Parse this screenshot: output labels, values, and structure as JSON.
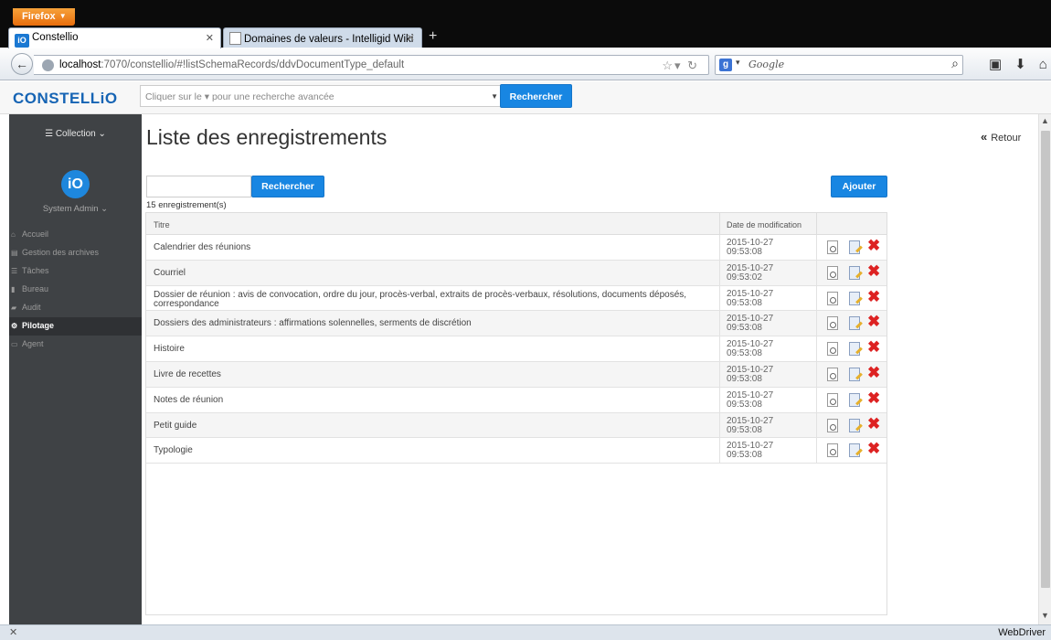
{
  "browser": {
    "menu_label": "Firefox",
    "tabs": [
      {
        "title": "Constellio",
        "favicon": "io"
      },
      {
        "title": "Domaines de valeurs - Intelligid Wiki",
        "favicon": "doc"
      }
    ],
    "url_host": "localhost",
    "url_rest": ":7070/constellio/#!listSchemaRecords/ddvDocumentType_default",
    "search_placeholder": "Google",
    "status_right": "WebDriver"
  },
  "app": {
    "logo": "CONSTELLiO",
    "search_placeholder": "Cliquer sur le ▾ pour une recherche avancée",
    "search_button": "Rechercher"
  },
  "sidebar": {
    "collection": "Collection",
    "avatar": "iO",
    "user": "System Admin",
    "items": [
      {
        "label": "Accueil",
        "icon": "home-icon",
        "active": false
      },
      {
        "label": "Gestion des archives",
        "icon": "archive-icon",
        "active": false
      },
      {
        "label": "Tâches",
        "icon": "tasks-icon",
        "active": false
      },
      {
        "label": "Bureau",
        "icon": "briefcase-icon",
        "active": false
      },
      {
        "label": "Audit",
        "icon": "audit-icon",
        "active": false
      },
      {
        "label": "Pilotage",
        "icon": "gears-icon",
        "active": true
      },
      {
        "label": "Agent",
        "icon": "laptop-icon",
        "active": false
      }
    ]
  },
  "main": {
    "title": "Liste des enregistrements",
    "back": "Retour",
    "search_button": "Rechercher",
    "add_button": "Ajouter",
    "count": "15 enregistrement(s)",
    "columns": [
      "Titre",
      "Date de modification"
    ],
    "rows": [
      {
        "title": "Calendrier des réunions",
        "date": "2015-10-27",
        "time": "09:53:08"
      },
      {
        "title": "Courriel",
        "date": "2015-10-27",
        "time": "09:53:02"
      },
      {
        "title": "Dossier de réunion : avis de convocation, ordre du jour, procès-verbal, extraits de procès-verbaux, résolutions, documents déposés, correspondance",
        "date": "2015-10-27",
        "time": "09:53:08"
      },
      {
        "title": "Dossiers des administrateurs : affirmations solennelles, serments de discrétion",
        "date": "2015-10-27",
        "time": "09:53:08"
      },
      {
        "title": "Histoire",
        "date": "2015-10-27",
        "time": "09:53:08"
      },
      {
        "title": "Livre de recettes",
        "date": "2015-10-27",
        "time": "09:53:08"
      },
      {
        "title": "Notes de réunion",
        "date": "2015-10-27",
        "time": "09:53:08"
      },
      {
        "title": "Petit guide",
        "date": "2015-10-27",
        "time": "09:53:08"
      },
      {
        "title": "Typologie",
        "date": "2015-10-27",
        "time": "09:53:08"
      }
    ]
  },
  "colors": {
    "brand": "#1664b4",
    "button": "#1886e2",
    "sidebar": "#3f4245",
    "delete": "#dd2222"
  }
}
